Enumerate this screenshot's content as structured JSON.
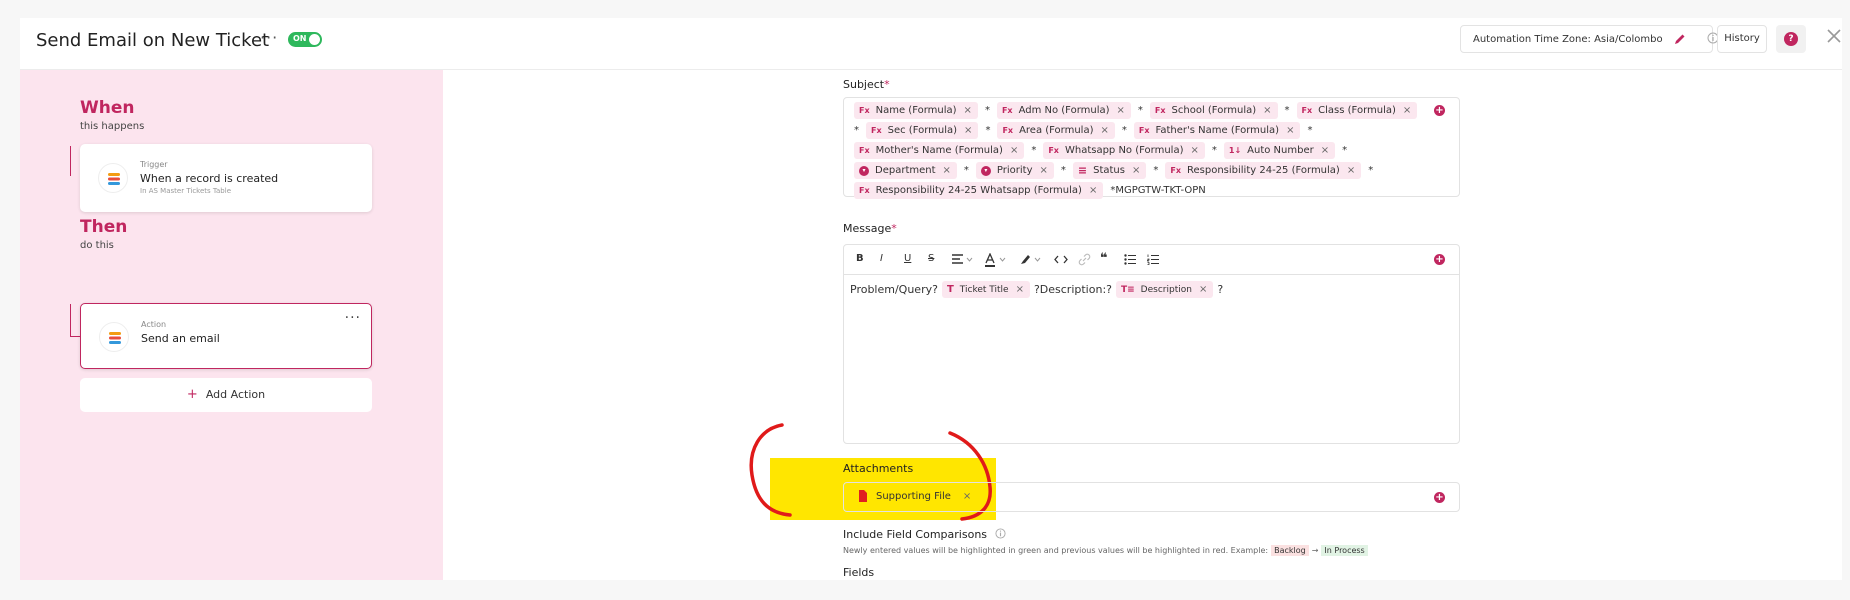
{
  "header": {
    "title": "Send Email on New Ticket",
    "more": "···",
    "toggle_label": "ON",
    "timezone_label": "Automation Time Zone: Asia/Colombo",
    "history_label": "History",
    "help_glyph": "?"
  },
  "colors": {
    "accent": "#c0265f",
    "toggle_on": "#2eb85c",
    "highlight": "#ffe600"
  },
  "flow": {
    "when_heading": "When",
    "when_sub": "this happens",
    "trigger": {
      "kind": "Trigger",
      "text": "When a record is created",
      "sub": "In AS Master Tickets Table"
    },
    "then_heading": "Then",
    "then_sub": "do this",
    "action": {
      "kind": "Action",
      "text": "Send an email",
      "menu": "···"
    },
    "add_action_label": "Add Action",
    "add_action_glyph": "+"
  },
  "subject": {
    "label": "Subject",
    "required": "*",
    "separator": "*",
    "tokens": [
      {
        "icon": "Fx",
        "label": "Name (Formula)"
      },
      {
        "icon": "Fx",
        "label": "Adm No (Formula)"
      },
      {
        "icon": "Fx",
        "label": "School (Formula)"
      },
      {
        "icon": "Fx",
        "label": "Class (Formula)"
      },
      {
        "icon": "Fx",
        "label": "Sec (Formula)"
      },
      {
        "icon": "Fx",
        "label": "Area (Formula)"
      },
      {
        "icon": "Fx",
        "label": "Father's Name (Formula)"
      },
      {
        "icon": "Fx",
        "label": "Mother's Name (Formula)"
      },
      {
        "icon": "Fx",
        "label": "Whatsapp No (Formula)"
      },
      {
        "icon": "1↓",
        "label": "Auto Number"
      },
      {
        "icon": "single-select-icon",
        "label": "Department"
      },
      {
        "icon": "single-select-icon",
        "label": "Priority"
      },
      {
        "icon": "≡",
        "label": "Status"
      },
      {
        "icon": "Fx",
        "label": "Responsibility 24-25 (Formula)"
      },
      {
        "icon": "Fx",
        "label": "Responsibility 24-25 Whatsapp (Formula)"
      }
    ],
    "trailing_text": "*MGPGTW-TKT-OPN"
  },
  "message": {
    "label": "Message",
    "required": "*",
    "toolbar": {
      "bold": "B",
      "italic": "I",
      "underline": "U",
      "strike": "S",
      "quote": "❝"
    },
    "text1": "Problem/Query?",
    "token1": {
      "icon": "T",
      "label": "Ticket Title"
    },
    "text2": "?Description:?",
    "token2": {
      "icon": "T≡",
      "label": "Description"
    },
    "text3": "?"
  },
  "attachments": {
    "label": "Attachments",
    "file_label": "Supporting File"
  },
  "field_comparisons": {
    "title": "Include Field Comparisons",
    "description": "Newly entered values will be highlighted in green and previous values will be highlighted in red. Example:",
    "example_old": "Backlog",
    "arrow": "→",
    "example_new": "In Process"
  },
  "fields_label": "Fields",
  "chip_remove": "×"
}
